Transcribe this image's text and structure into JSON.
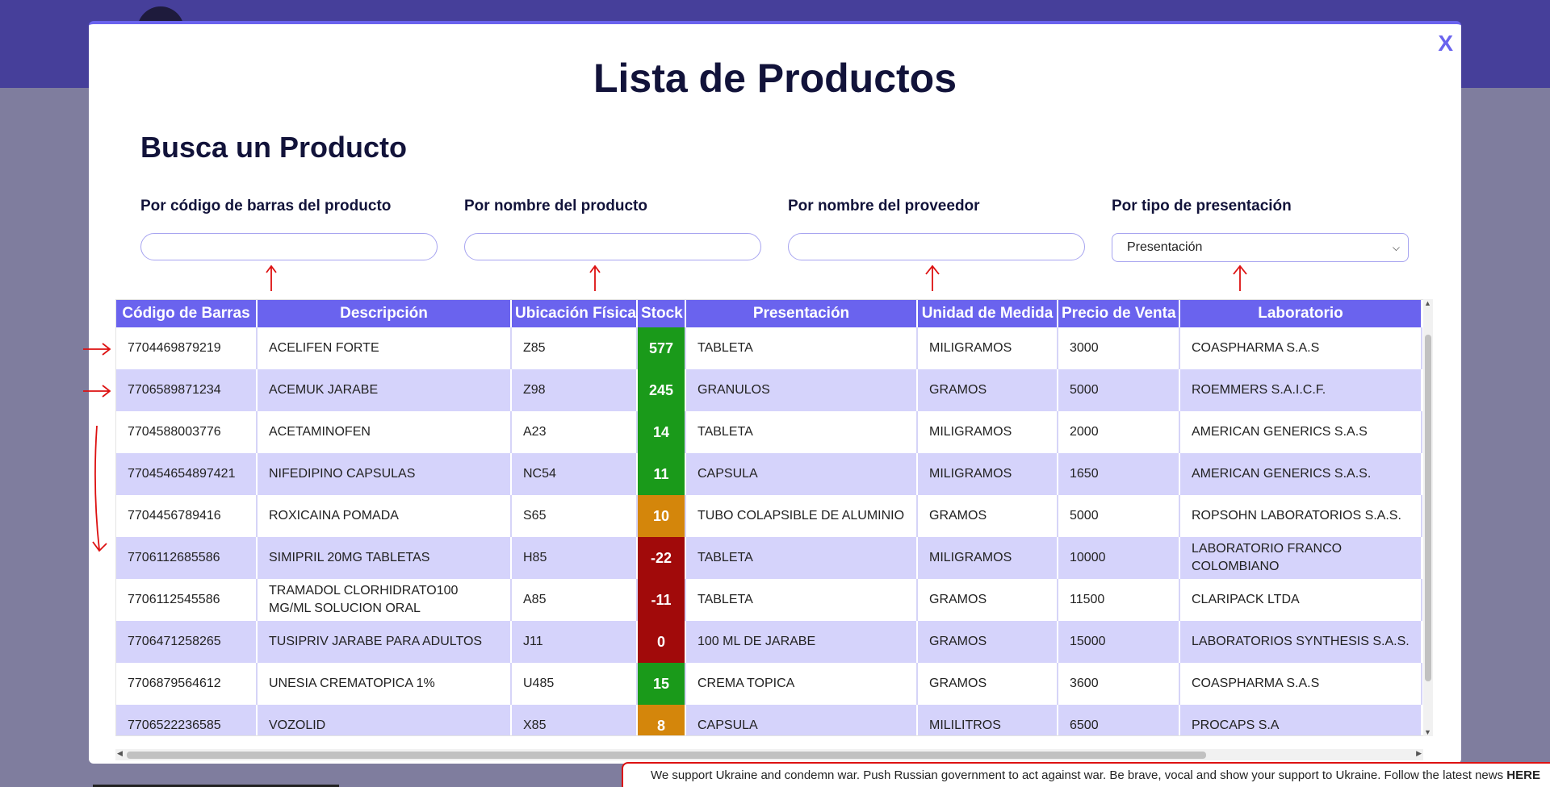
{
  "modal": {
    "close_label": "X",
    "title": "Lista de Productos",
    "section_title": "Busca un Producto"
  },
  "filters": {
    "barcode_label": "Por código de barras del producto",
    "name_label": "Por nombre del producto",
    "supplier_label": "Por nombre del proveedor",
    "presentation_label": "Por tipo de presentación",
    "barcode_value": "",
    "name_value": "",
    "supplier_value": "",
    "presentation_selected": "Presentación"
  },
  "table": {
    "columns": [
      "Código de Barras",
      "Descripción",
      "Ubicación Física",
      "Stock",
      "Presentación",
      "Unidad de Medida",
      "Precio de Venta",
      "Laboratorio"
    ],
    "rows": [
      {
        "barcode": "7704469879219",
        "description": "ACELIFEN FORTE",
        "location": "Z85",
        "stock": "577",
        "presentation": "TABLETA",
        "unit": "MILIGRAMOS",
        "price": "3000",
        "lab": "COASPHARMA S.A.S"
      },
      {
        "barcode": "7706589871234",
        "description": "ACEMUK JARABE",
        "location": "Z98",
        "stock": "245",
        "presentation": "GRANULOS",
        "unit": "GRAMOS",
        "price": "5000",
        "lab": "ROEMMERS S.A.I.C.F."
      },
      {
        "barcode": "7704588003776",
        "description": "ACETAMINOFEN",
        "location": "A23",
        "stock": "14",
        "presentation": "TABLETA",
        "unit": "MILIGRAMOS",
        "price": "2000",
        "lab": "AMERICAN GENERICS S.A.S"
      },
      {
        "barcode": "770454654897421",
        "description": "NIFEDIPINO CAPSULAS",
        "location": "NC54",
        "stock": "11",
        "presentation": "CAPSULA",
        "unit": "MILIGRAMOS",
        "price": "1650",
        "lab": "AMERICAN GENERICS S.A.S."
      },
      {
        "barcode": "7704456789416",
        "description": "ROXICAINA POMADA",
        "location": "S65",
        "stock": "10",
        "presentation": "TUBO COLAPSIBLE DE ALUMINIO",
        "unit": "GRAMOS",
        "price": "5000",
        "lab": "ROPSOHN LABORATORIOS S.A.S."
      },
      {
        "barcode": "7706112685586",
        "description": "SIMIPRIL 20MG TABLETAS",
        "location": "H85",
        "stock": "-22",
        "presentation": "TABLETA",
        "unit": "MILIGRAMOS",
        "price": "10000",
        "lab": "LABORATORIO FRANCO COLOMBIANO"
      },
      {
        "barcode": "7706112545586",
        "description": "TRAMADOL CLORHIDRATO100 MG/ML SOLUCION ORAL",
        "location": "A85",
        "stock": "-11",
        "presentation": "TABLETA",
        "unit": "GRAMOS",
        "price": "11500",
        "lab": "CLARIPACK LTDA"
      },
      {
        "barcode": "7706471258265",
        "description": "TUSIPRIV JARABE PARA ADULTOS",
        "location": "J11",
        "stock": "0",
        "presentation": "100 ML DE JARABE",
        "unit": "GRAMOS",
        "price": "15000",
        "lab": "LABORATORIOS SYNTHESIS S.A.S."
      },
      {
        "barcode": "7706879564612",
        "description": "UNESIA CREMATOPICA 1%",
        "location": "U485",
        "stock": "15",
        "presentation": "CREMA TOPICA",
        "unit": "GRAMOS",
        "price": "3600",
        "lab": "COASPHARMA S.A.S"
      },
      {
        "barcode": "7706522236585",
        "description": "VOZOLID",
        "location": "X85",
        "stock": "8",
        "presentation": "CAPSULA",
        "unit": "MILILITROS",
        "price": "6500",
        "lab": "PROCAPS S.A"
      }
    ]
  },
  "stock_colors": {
    "high": "#1a9a1a",
    "medium": "#d4860b",
    "low": "#a10a0a"
  },
  "banner": {
    "text": "We support Ukraine and condemn war. Push Russian government to act against war. Be brave, vocal and show your support to Ukraine. Follow the latest news ",
    "link": "HERE"
  }
}
